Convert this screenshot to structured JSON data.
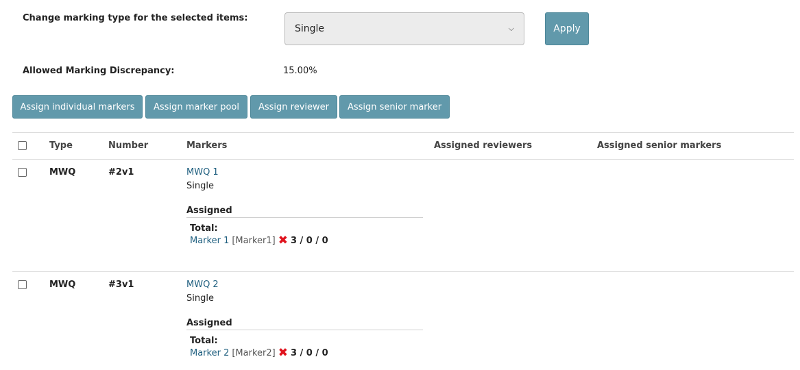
{
  "marking_type": {
    "label": "Change marking type for the selected items:",
    "selected": "Single",
    "apply_label": "Apply"
  },
  "discrepancy": {
    "label": "Allowed Marking Discrepancy:",
    "value": "15.00%"
  },
  "actions": [
    "Assign individual markers",
    "Assign marker pool",
    "Assign reviewer",
    "Assign senior marker"
  ],
  "table": {
    "headers": {
      "type": "Type",
      "number": "Number",
      "markers": "Markers",
      "reviewers": "Assigned reviewers",
      "senior": "Assigned senior markers"
    },
    "rows": [
      {
        "type": "MWQ",
        "number": "#2v1",
        "item_link": "MWQ 1",
        "item_mode": "Single",
        "assigned_label": "Assigned",
        "total_label": "Total:",
        "marker_name": "Marker 1",
        "marker_id": "[Marker1]",
        "score": "3 / 0 / 0"
      },
      {
        "type": "MWQ",
        "number": "#3v1",
        "item_link": "MWQ 2",
        "item_mode": "Single",
        "assigned_label": "Assigned",
        "total_label": "Total:",
        "marker_name": "Marker 2",
        "marker_id": "[Marker2]",
        "score": "3 / 0 / 0"
      }
    ]
  },
  "colors": {
    "button_bg": "#6199ab",
    "link": "#1f5f7f",
    "error_cross": "#e0141e"
  }
}
